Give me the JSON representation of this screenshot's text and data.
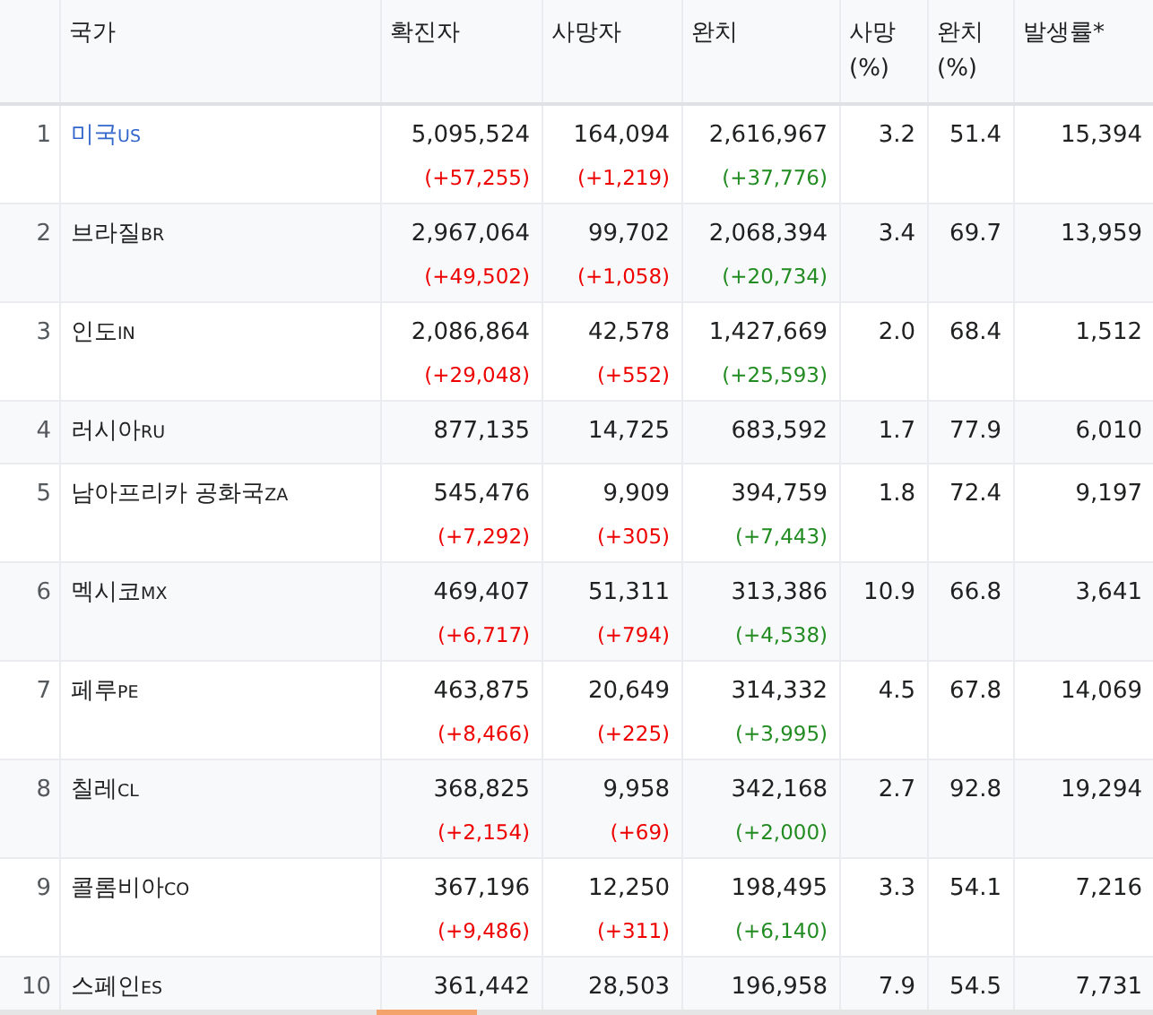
{
  "table": {
    "columns": [
      "국가",
      "확진자",
      "사망자",
      "완치",
      "사망 (%)",
      "완치 (%)",
      "발생률*"
    ],
    "rows": [
      {
        "rank": "1",
        "country": "미국",
        "code": "US",
        "link": true,
        "confirmed": "5,095,524",
        "confirmed_change": "(+57,255)",
        "deaths": "164,094",
        "deaths_change": "(+1,219)",
        "recovered": "2,616,967",
        "recovered_change": "(+37,776)",
        "death_rate": "3.2",
        "recovery_rate": "51.4",
        "incidence": "15,394"
      },
      {
        "rank": "2",
        "country": "브라질",
        "code": "BR",
        "link": false,
        "confirmed": "2,967,064",
        "confirmed_change": "(+49,502)",
        "deaths": "99,702",
        "deaths_change": "(+1,058)",
        "recovered": "2,068,394",
        "recovered_change": "(+20,734)",
        "death_rate": "3.4",
        "recovery_rate": "69.7",
        "incidence": "13,959"
      },
      {
        "rank": "3",
        "country": "인도",
        "code": "IN",
        "link": false,
        "confirmed": "2,086,864",
        "confirmed_change": "(+29,048)",
        "deaths": "42,578",
        "deaths_change": "(+552)",
        "recovered": "1,427,669",
        "recovered_change": "(+25,593)",
        "death_rate": "2.0",
        "recovery_rate": "68.4",
        "incidence": "1,512"
      },
      {
        "rank": "4",
        "country": "러시아",
        "code": "RU",
        "link": false,
        "confirmed": "877,135",
        "deaths": "14,725",
        "recovered": "683,592",
        "death_rate": "1.7",
        "recovery_rate": "77.9",
        "incidence": "6,010"
      },
      {
        "rank": "5",
        "country": "남아프리카 공화국",
        "code": "ZA",
        "link": false,
        "confirmed": "545,476",
        "confirmed_change": "(+7,292)",
        "deaths": "9,909",
        "deaths_change": "(+305)",
        "recovered": "394,759",
        "recovered_change": "(+7,443)",
        "death_rate": "1.8",
        "recovery_rate": "72.4",
        "incidence": "9,197"
      },
      {
        "rank": "6",
        "country": "멕시코",
        "code": "MX",
        "link": false,
        "confirmed": "469,407",
        "confirmed_change": "(+6,717)",
        "deaths": "51,311",
        "deaths_change": "(+794)",
        "recovered": "313,386",
        "recovered_change": "(+4,538)",
        "death_rate": "10.9",
        "recovery_rate": "66.8",
        "incidence": "3,641"
      },
      {
        "rank": "7",
        "country": "페루",
        "code": "PE",
        "link": false,
        "confirmed": "463,875",
        "confirmed_change": "(+8,466)",
        "deaths": "20,649",
        "deaths_change": "(+225)",
        "recovered": "314,332",
        "recovered_change": "(+3,995)",
        "death_rate": "4.5",
        "recovery_rate": "67.8",
        "incidence": "14,069"
      },
      {
        "rank": "8",
        "country": "칠레",
        "code": "CL",
        "link": false,
        "confirmed": "368,825",
        "confirmed_change": "(+2,154)",
        "deaths": "9,958",
        "deaths_change": "(+69)",
        "recovered": "342,168",
        "recovered_change": "(+2,000)",
        "death_rate": "2.7",
        "recovery_rate": "92.8",
        "incidence": "19,294"
      },
      {
        "rank": "9",
        "country": "콜롬비아",
        "code": "CO",
        "link": false,
        "confirmed": "367,196",
        "confirmed_change": "(+9,486)",
        "deaths": "12,250",
        "deaths_change": "(+311)",
        "recovered": "198,495",
        "recovered_change": "(+6,140)",
        "death_rate": "3.3",
        "recovery_rate": "54.1",
        "incidence": "7,216"
      },
      {
        "rank": "10",
        "country": "스페인",
        "code": "ES",
        "link": false,
        "confirmed": "361,442",
        "deaths": "28,503",
        "recovered": "196,958",
        "death_rate": "7.9",
        "recovery_rate": "54.5",
        "incidence": "7,731"
      }
    ]
  }
}
